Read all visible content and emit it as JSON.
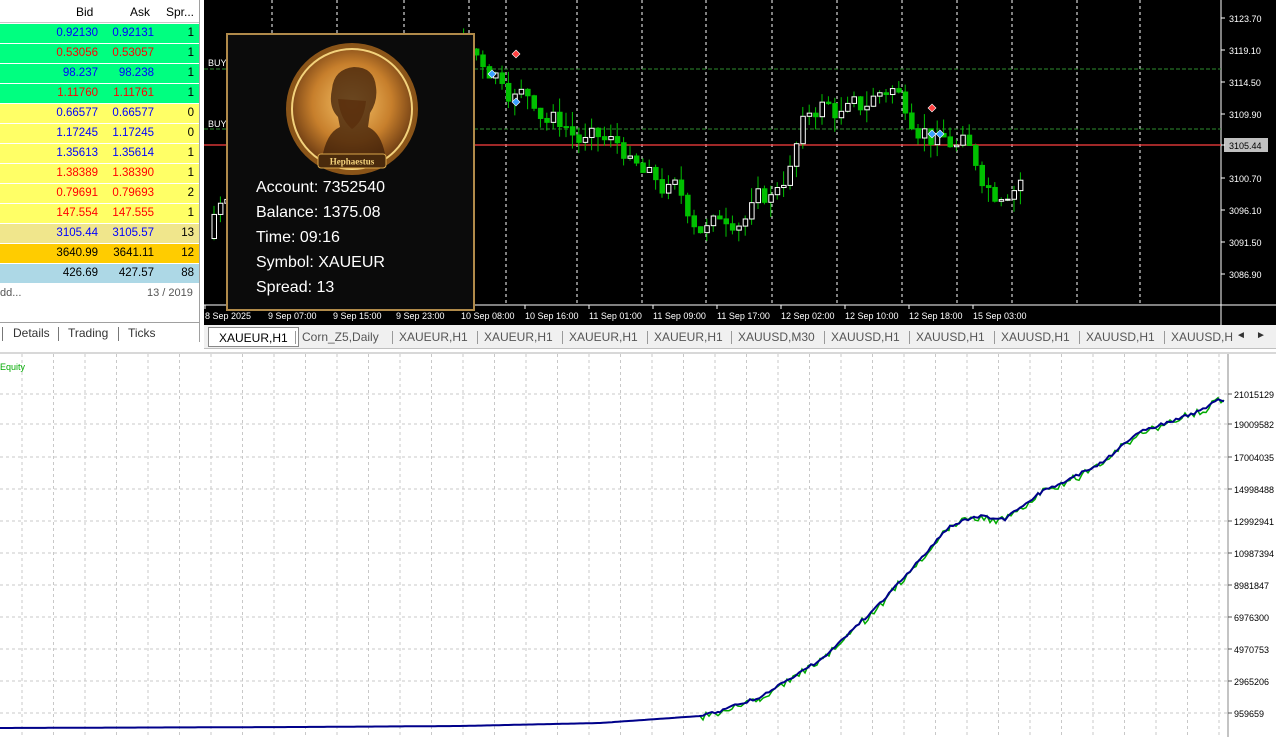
{
  "market_watch": {
    "headers": {
      "bid": "Bid",
      "ask": "Ask",
      "spread": "Spr..."
    },
    "rows": [
      {
        "bid": "0.92130",
        "ask": "0.92131",
        "spread": "1",
        "bg": "#00ff80",
        "fg": "#0000ff"
      },
      {
        "bid": "0.53056",
        "ask": "0.53057",
        "spread": "1",
        "bg": "#00ff80",
        "fg": "#ff0000"
      },
      {
        "bid": "98.237",
        "ask": "98.238",
        "spread": "1",
        "bg": "#00ff80",
        "fg": "#0000ff"
      },
      {
        "bid": "1.11760",
        "ask": "1.11761",
        "spread": "1",
        "bg": "#00ff80",
        "fg": "#ff0000"
      },
      {
        "bid": "0.66577",
        "ask": "0.66577",
        "spread": "0",
        "bg": "#ffff66",
        "fg": "#0000ff"
      },
      {
        "bid": "1.17245",
        "ask": "1.17245",
        "spread": "0",
        "bg": "#ffff66",
        "fg": "#0000ff"
      },
      {
        "bid": "1.35613",
        "ask": "1.35614",
        "spread": "1",
        "bg": "#ffff66",
        "fg": "#0000ff"
      },
      {
        "bid": "1.38389",
        "ask": "1.38390",
        "spread": "1",
        "bg": "#ffff66",
        "fg": "#ff0000"
      },
      {
        "bid": "0.79691",
        "ask": "0.79693",
        "spread": "2",
        "bg": "#ffff66",
        "fg": "#ff0000"
      },
      {
        "bid": "147.554",
        "ask": "147.555",
        "spread": "1",
        "bg": "#ffff66",
        "fg": "#ff0000"
      },
      {
        "bid": "3105.44",
        "ask": "3105.57",
        "spread": "13",
        "bg": "#f0e68c",
        "fg": "#0000ff"
      },
      {
        "bid": "3640.99",
        "ask": "3641.11",
        "spread": "12",
        "bg": "#ffcc00",
        "fg": "#000000"
      },
      {
        "bid": "426.69",
        "ask": "427.57",
        "spread": "88",
        "bg": "#add8e6",
        "fg": "#000000"
      }
    ],
    "footer_left": "dd...",
    "footer_right": "13 / 2019",
    "tabs": [
      "Details",
      "Trading",
      "Ticks"
    ]
  },
  "price_chart": {
    "price_labels": [
      "3123.70",
      "3119.10",
      "3114.50",
      "3109.90",
      "3105.44",
      "3100.70",
      "3096.10",
      "3091.50",
      "3086.90"
    ],
    "current_price": "3105.44",
    "time_labels": [
      "8 Sep 2025",
      "9 Sep 07:00",
      "9 Sep 15:00",
      "9 Sep 23:00",
      "10 Sep 08:00",
      "10 Sep 16:00",
      "11 Sep 01:00",
      "11 Sep 09:00",
      "11 Sep 17:00",
      "12 Sep 02:00",
      "12 Sep 10:00",
      "12 Sep 18:00",
      "15 Sep 03:00"
    ],
    "buy_label": "BUY",
    "colors": {
      "bull": "#ffffff",
      "bear": "#00c000",
      "grid": "#ffffff",
      "price_line": "#ff4040",
      "level": "#2e8b2e"
    }
  },
  "info_panel": {
    "badge": "Hephaestus",
    "account": "Account: 7352540",
    "balance": "Balance: 1375.08",
    "time": "Time: 09:16",
    "symbol": "Symbol: XAUEUR",
    "spread": "Spread: 13"
  },
  "chart_tabs": [
    "XAUEUR,H1",
    "Corn_Z5,Daily",
    "XAUEUR,H1",
    "XAUEUR,H1",
    "XAUEUR,H1",
    "XAUEUR,H1",
    "XAUUSD,M30",
    "XAUUSD,H1",
    "XAUUSD,H1",
    "XAUUSD,H1",
    "XAUUSD,H1",
    "XAUUSD,H"
  ],
  "equity_chart": {
    "legend": "Equity",
    "y_labels": [
      "21015129",
      "19009582",
      "17004035",
      "14998488",
      "12992941",
      "10987394",
      "8981847",
      "6976300",
      "4970753",
      "2965206",
      "959659"
    ],
    "colors": {
      "balance": "#00008b",
      "equity": "#00aa00"
    }
  }
}
